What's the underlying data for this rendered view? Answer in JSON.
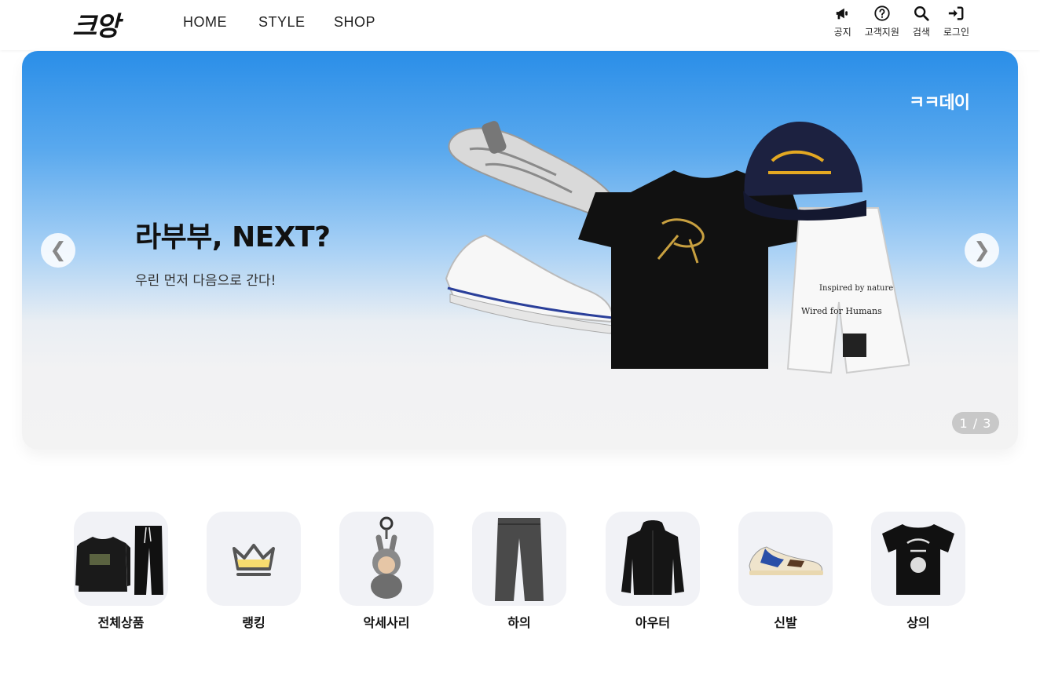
{
  "header": {
    "logo": "크앙",
    "nav": [
      "HOME",
      "STYLE",
      "SHOP"
    ],
    "utils": [
      {
        "label": "공지",
        "icon": "megaphone-icon"
      },
      {
        "label": "고객지원",
        "icon": "question-icon"
      },
      {
        "label": "검색",
        "icon": "search-icon"
      },
      {
        "label": "로그인",
        "icon": "login-icon"
      }
    ]
  },
  "banner": {
    "brand": "ㅋㅋ데이",
    "title": "라부부, NEXT?",
    "subtitle": "우린 먼저 다음으로 간다!",
    "pager": "1 / 3",
    "prev_icon": "❮",
    "next_icon": "❯"
  },
  "categories": [
    {
      "label": "전체상품",
      "icon": "sweatsuit-icon"
    },
    {
      "label": "랭킹",
      "icon": "crown-icon"
    },
    {
      "label": "악세사리",
      "icon": "keychain-doll-icon"
    },
    {
      "label": "하의",
      "icon": "pants-icon"
    },
    {
      "label": "아우터",
      "icon": "jacket-icon"
    },
    {
      "label": "신발",
      "icon": "sneaker-icon"
    },
    {
      "label": "상의",
      "icon": "tshirt-icon"
    }
  ],
  "colors": {
    "banner_top": "#2a8ee8",
    "banner_bottom": "#f3f3f3",
    "category_bg": "#f1f2f6",
    "crown_fill": "#f7dc6f"
  }
}
